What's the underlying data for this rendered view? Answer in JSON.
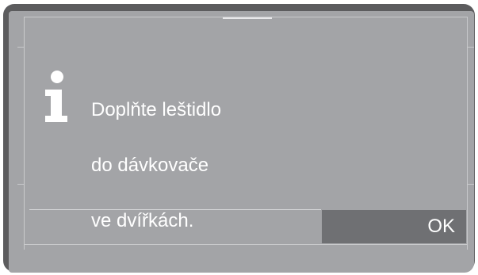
{
  "dialog": {
    "icon": "info-icon",
    "message_lines": [
      "Doplňte leštidlo",
      "do dávkovače",
      "ve dvířkách."
    ],
    "ok_label": "OK"
  },
  "colors": {
    "bezel": "#5c5c5e",
    "screen": "#a3a4a7",
    "button": "#6f7073",
    "text": "#ffffff"
  }
}
